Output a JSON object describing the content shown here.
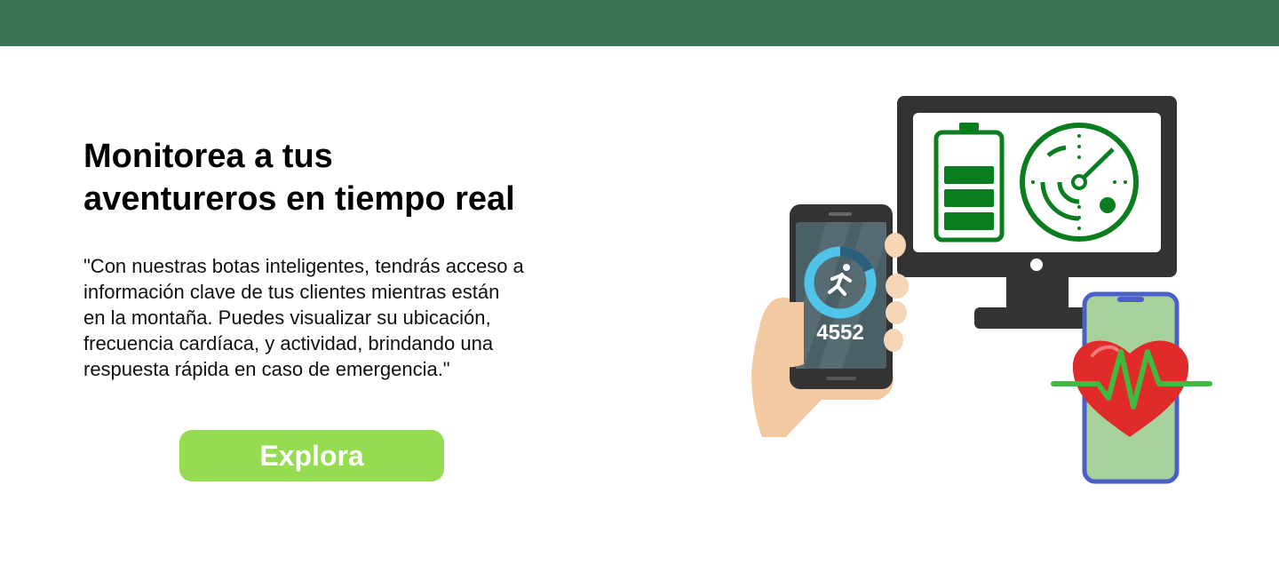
{
  "hero": {
    "title_lines": [
      "Monitorea a tus",
      "aventureros en tiempo real"
    ],
    "description_lines": [
      "\"Con nuestras botas inteligentes, tendrás acceso a",
      "información clave de tus clientes mientras están",
      "en la montaña. Puedes visualizar su ubicación,",
      "frecuencia cardíaca, y actividad, brindando una",
      "respuesta rápida en caso de emergencia.\""
    ],
    "cta_label": "Explora"
  },
  "illustration": {
    "step_count": "4552",
    "icons": [
      "battery-icon",
      "radar-icon",
      "running-person-icon",
      "heart-rate-icon"
    ]
  },
  "colors": {
    "topbar": "#3a7355",
    "cta": "#96dc50",
    "accent_green": "#0a7d1f",
    "heart_red": "#e12a2a",
    "phone_blue": "#4a5fc9"
  }
}
